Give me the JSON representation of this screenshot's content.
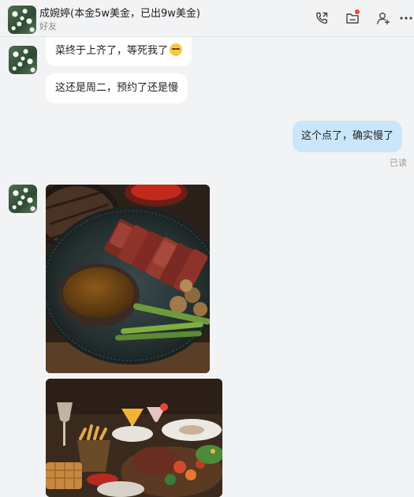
{
  "header": {
    "title": "成婉婷(本金5w美金，已出9w美金)",
    "subtitle": "好友",
    "icons": [
      "phone-call-icon",
      "folder-icon",
      "add-friend-icon",
      "more-icon"
    ]
  },
  "messages": [
    {
      "side": "left",
      "text": "菜终于上齐了，等死我了",
      "emoji": "relieved-face-icon"
    },
    {
      "side": "left",
      "text": "这还是周二，预约了还是慢"
    },
    {
      "side": "right",
      "text": "这个点了，确实慢了",
      "status": "已读"
    },
    {
      "side": "left",
      "type": "image",
      "image": "steak-photo"
    },
    {
      "side": "left",
      "type": "image",
      "image": "food-table-photo"
    }
  ],
  "colors": {
    "background": "#f2f3f5",
    "bubble_in": "#ffffff",
    "bubble_out": "#c9e6fb",
    "badge": "#f53f3f"
  }
}
